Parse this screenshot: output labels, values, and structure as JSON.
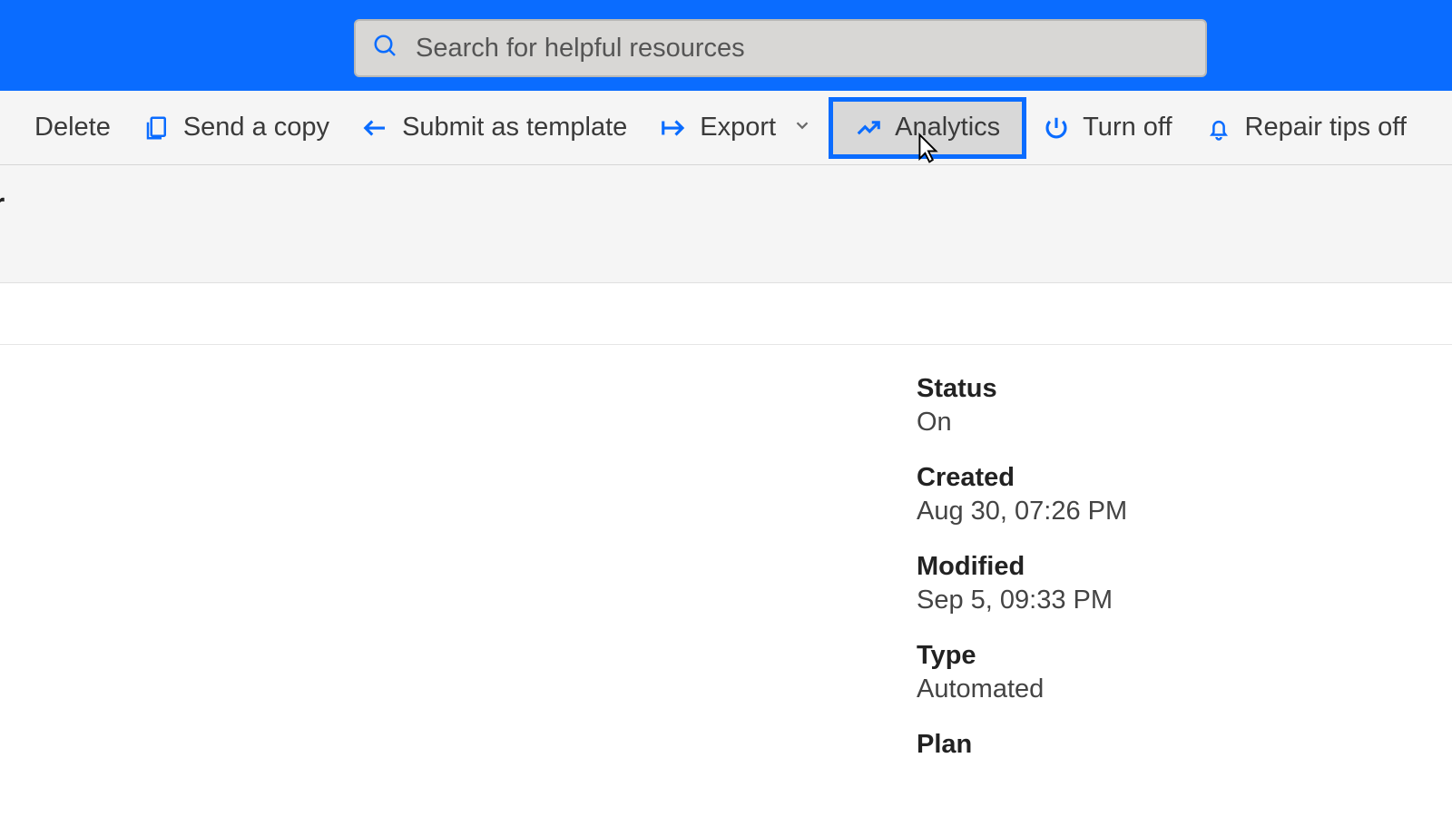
{
  "search": {
    "placeholder": "Search for helpful resources"
  },
  "commands": {
    "delete": "Delete",
    "send_copy": "Send a copy",
    "submit_template": "Submit as template",
    "export": "Export",
    "analytics": "Analytics",
    "turn_off": "Turn off",
    "repair_tips": "Repair tips off"
  },
  "page_title_suffix": "r",
  "details": {
    "status": {
      "label": "Status",
      "value": "On"
    },
    "created": {
      "label": "Created",
      "value": "Aug 30, 07:26 PM"
    },
    "modified": {
      "label": "Modified",
      "value": "Sep 5, 09:33 PM"
    },
    "type": {
      "label": "Type",
      "value": "Automated"
    },
    "plan": {
      "label": "Plan",
      "value": ""
    }
  }
}
